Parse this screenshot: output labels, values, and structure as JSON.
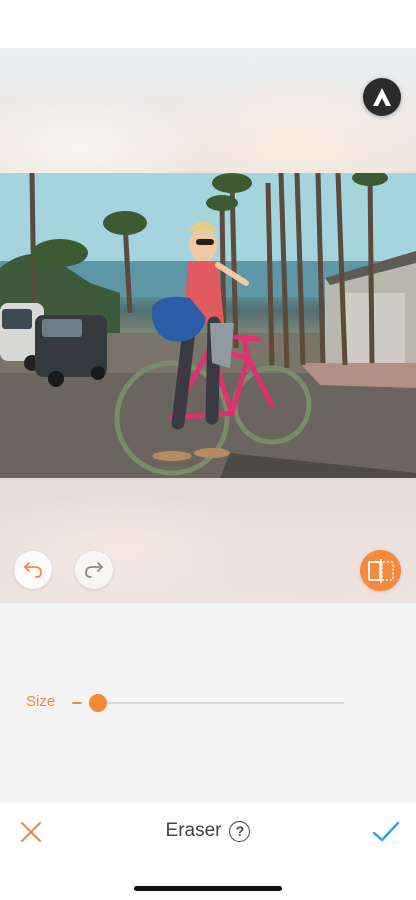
{
  "canvas": {
    "brand_icon": "app-logo-icon",
    "photo_description_icon": "photo-canvas",
    "undo_icon": "undo-arrow-icon",
    "redo_icon": "redo-arrow-icon",
    "compare_icon": "compare-split-icon"
  },
  "controls": {
    "size_label": "Size",
    "size_value_fraction": 0.01
  },
  "bottom_bar": {
    "title": "Eraser",
    "help_symbol": "?",
    "close_icon": "close-x-icon",
    "confirm_icon": "checkmark-icon"
  },
  "colors": {
    "accent": "#f58a3e",
    "text": "#444444",
    "panel_bg": "#f4f4f4"
  }
}
